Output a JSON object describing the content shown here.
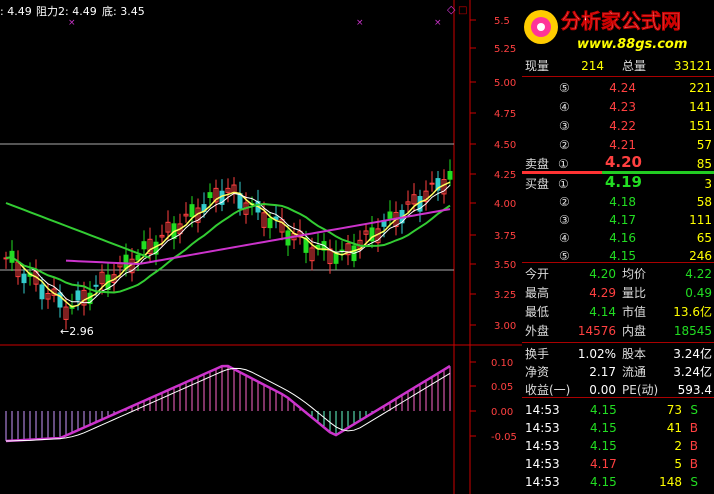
{
  "indicator_line": {
    "value_prefix": ": 4.49",
    "resistance": "阻力2: 4.49",
    "bottom": "底: 3.45"
  },
  "logo": {
    "name": "分析家公式网",
    "url": "www.88gs.com"
  },
  "low_marker": "←2.96",
  "chart_data": [
    {
      "type": "candlestick",
      "yaxis_ticks": [
        "5.5",
        "5.25",
        "5.00",
        "4.75",
        "4.50",
        "4.25",
        "4.00",
        "3.75",
        "3.50",
        "3.25",
        "3.00"
      ],
      "ylim": [
        2.96,
        5.5
      ]
    },
    {
      "type": "bar",
      "yaxis_ticks": [
        "0.10",
        "0.05",
        "0.00",
        "-0.05"
      ],
      "ylim": [
        -0.07,
        0.12
      ]
    }
  ],
  "quote": {
    "volume_label": "现量",
    "volume": "214",
    "total_label": "总量",
    "total": "33121",
    "asks": [
      {
        "level": "⑤",
        "price": "4.24",
        "vol": "221"
      },
      {
        "level": "④",
        "price": "4.23",
        "vol": "141"
      },
      {
        "level": "③",
        "price": "4.22",
        "vol": "151"
      },
      {
        "level": "②",
        "price": "4.21",
        "vol": "57"
      },
      {
        "level": "①",
        "price": "4.20",
        "vol": "85"
      }
    ],
    "ask_label": "卖盘",
    "bid_label": "买盘",
    "bids": [
      {
        "level": "①",
        "price": "4.19",
        "vol": "3"
      },
      {
        "level": "②",
        "price": "4.18",
        "vol": "58"
      },
      {
        "level": "③",
        "price": "4.17",
        "vol": "111"
      },
      {
        "level": "④",
        "price": "4.16",
        "vol": "65"
      },
      {
        "level": "⑤",
        "price": "4.15",
        "vol": "246"
      }
    ],
    "stats": [
      {
        "l1": "今开",
        "v1": "4.20",
        "l2": "均价",
        "v2": "4.22"
      },
      {
        "l1": "最高",
        "v1": "4.29",
        "l2": "量比",
        "v2": "0.49"
      },
      {
        "l1": "最低",
        "v1": "4.14",
        "l2": "市值",
        "v2": "13.6亿"
      },
      {
        "l1": "外盘",
        "v1": "14576",
        "l2": "内盘",
        "v2": "18545"
      }
    ],
    "fundamentals": [
      {
        "l1": "换手",
        "v1": "1.02%",
        "l2": "股本",
        "v2": "3.24亿"
      },
      {
        "l1": "净资",
        "v1": "2.17",
        "l2": "流通",
        "v2": "3.24亿"
      },
      {
        "l1": "收益(一)",
        "v1": "0.00",
        "l2": "PE(动)",
        "v2": "593.4"
      }
    ],
    "ticks": [
      {
        "time": "14:53",
        "price": "4.15",
        "vol": "73",
        "side": "S"
      },
      {
        "time": "14:53",
        "price": "4.15",
        "vol": "41",
        "side": "B"
      },
      {
        "time": "14:53",
        "price": "4.15",
        "vol": "2",
        "side": "B"
      },
      {
        "time": "14:53",
        "price": "4.17",
        "vol": "5",
        "side": "B"
      },
      {
        "time": "14:53",
        "price": "4.15",
        "vol": "148",
        "side": "S"
      }
    ]
  },
  "colors": {
    "up": "#ff4040",
    "down": "#22dd22",
    "ma_fast": "#ffff60",
    "ma_mid": "#ffffff",
    "ma_slow": "#33cc33",
    "ma_long": "#cc33cc",
    "grid": "#cc0000"
  }
}
